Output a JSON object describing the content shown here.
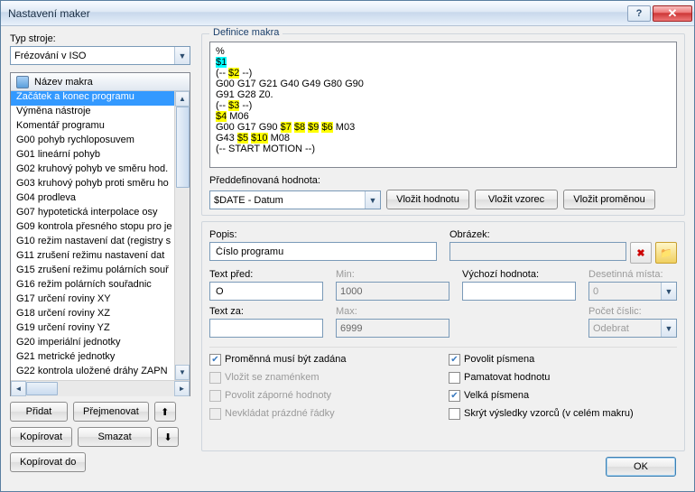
{
  "window": {
    "title": "Nastavení maker"
  },
  "left": {
    "machine_type_label": "Typ stroje:",
    "machine_type_value": "Frézování v ISO",
    "list_header": "Název makra",
    "items": [
      "Začátek a konec programu",
      "Výměna nástroje",
      "Komentář programu",
      "G00 pohyb rychloposuvem",
      "G01 lineární pohyb",
      "G02 kruhový pohyb ve směru hod.",
      "G03 kruhový pohyb proti směru ho",
      "G04 prodleva",
      "G07 hypotetická interpolace osy",
      "G09 kontrola přesného stopu pro je",
      "G10 režim nastavení dat (registry s",
      "G11 zrušení režimu nastavení dat",
      "G15 zrušení režimu polárních souř",
      "G16 režim polárních souřadnic",
      "G17 určení roviny XY",
      "G18 určení roviny XZ",
      "G19 určení roviny YZ",
      "G20 imperiální jednotky",
      "G21 metrické jednotky",
      "G22 kontrola uložené dráhy ZAPN"
    ],
    "buttons": {
      "add": "Přidat",
      "rename": "Přejmenovat",
      "copy": "Kopírovat",
      "delete": "Smazat",
      "copy_to": "Kopírovat do"
    }
  },
  "right": {
    "definition_title": "Definice makra",
    "macro_lines": [
      {
        "t": "%",
        "hl": ""
      },
      {
        "t": "$1",
        "hl": "sel"
      },
      {
        "t": "(-- ",
        "s": [
          {
            "t": "$2",
            "hl": "y"
          },
          {
            "t": " --)"
          }
        ]
      },
      {
        "t": "G00 G17 G21 G40 G49 G80 G90"
      },
      {
        "t": "G91 G28 Z0."
      },
      {
        "t": "(-- ",
        "s": [
          {
            "t": "$3",
            "hl": "y"
          },
          {
            "t": " --)"
          }
        ]
      },
      {
        "s": [
          {
            "t": "$4",
            "hl": "y"
          },
          {
            "t": " M06"
          }
        ]
      },
      {
        "t": "G00 G17 G90 ",
        "s": [
          {
            "t": "$7",
            "hl": "y"
          },
          {
            "t": " "
          },
          {
            "t": "$8",
            "hl": "y"
          },
          {
            "t": " "
          },
          {
            "t": "$9",
            "hl": "y"
          },
          {
            "t": " "
          },
          {
            "t": "$6",
            "hl": "y"
          },
          {
            "t": " M03"
          }
        ]
      },
      {
        "t": "G43 ",
        "s": [
          {
            "t": "$5",
            "hl": "y"
          },
          {
            "t": " "
          },
          {
            "t": "$10",
            "hl": "y"
          },
          {
            "t": " M08"
          }
        ]
      },
      {
        "t": "(-- START MOTION --)"
      }
    ],
    "predef_label": "Předdefinovaná hodnota:",
    "predef_value": "$DATE - Datum",
    "btn_insert_value": "Vložit hodnotu",
    "btn_insert_pattern": "Vložit vzorec",
    "btn_insert_variable": "Vložit proměnou",
    "desc_label": "Popis:",
    "desc_value": "Číslo programu",
    "image_label": "Obrázek:",
    "text_before_label": "Text před:",
    "text_before_value": "O",
    "min_label": "Min:",
    "min_value": "1000",
    "default_label": "Výchozí hodnota:",
    "default_value": "",
    "decimals_label": "Desetinná místa:",
    "decimals_value": "0",
    "text_after_label": "Text za:",
    "text_after_value": "",
    "max_label": "Max:",
    "max_value": "6999",
    "digits_label": "Počet číslic:",
    "digits_value": "Odebrat",
    "checks": {
      "must_enter": "Proměnná musí být zadána",
      "signed": "Vložit se znaménkem",
      "neg": "Povolit záporné hodnoty",
      "noempty": "Nevkládat prázdné řádky",
      "letters": "Povolit písmena",
      "remember": "Pamatovat hodnotu",
      "upper": "Velká písmena",
      "hide": "Skrýt výsledky vzorců (v celém makru)"
    },
    "ok": "OK"
  }
}
